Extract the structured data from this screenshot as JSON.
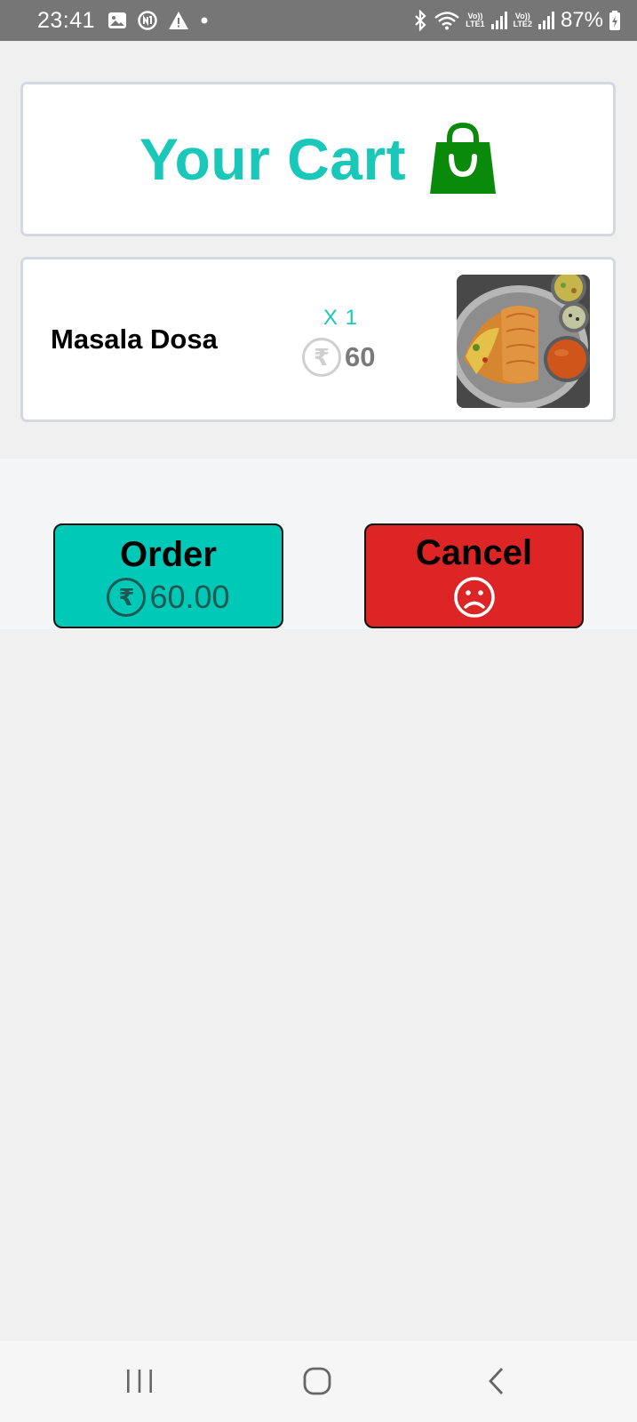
{
  "status_bar": {
    "time": "23:41",
    "battery": "87%",
    "net1": "LTE1",
    "net2": "LTE2",
    "volte": "Vo))"
  },
  "header": {
    "title": "Your Cart",
    "icon": "shopping-bag-icon",
    "icon_color": "#0a8a0a",
    "title_color": "#19c8b9"
  },
  "cart_items": [
    {
      "name": "Masala Dosa",
      "quantity": "X 1",
      "price": "60",
      "currency_symbol": "₹"
    }
  ],
  "actions": {
    "order_label": "Order",
    "order_total": "60.00",
    "order_currency_symbol": "₹",
    "order_color": "#00c9b8",
    "cancel_label": "Cancel",
    "cancel_icon": "sad-face-icon",
    "cancel_color": "#dd2525"
  },
  "nav_bar": {
    "recent": "recent-apps-icon",
    "home": "home-icon",
    "back": "back-icon"
  }
}
